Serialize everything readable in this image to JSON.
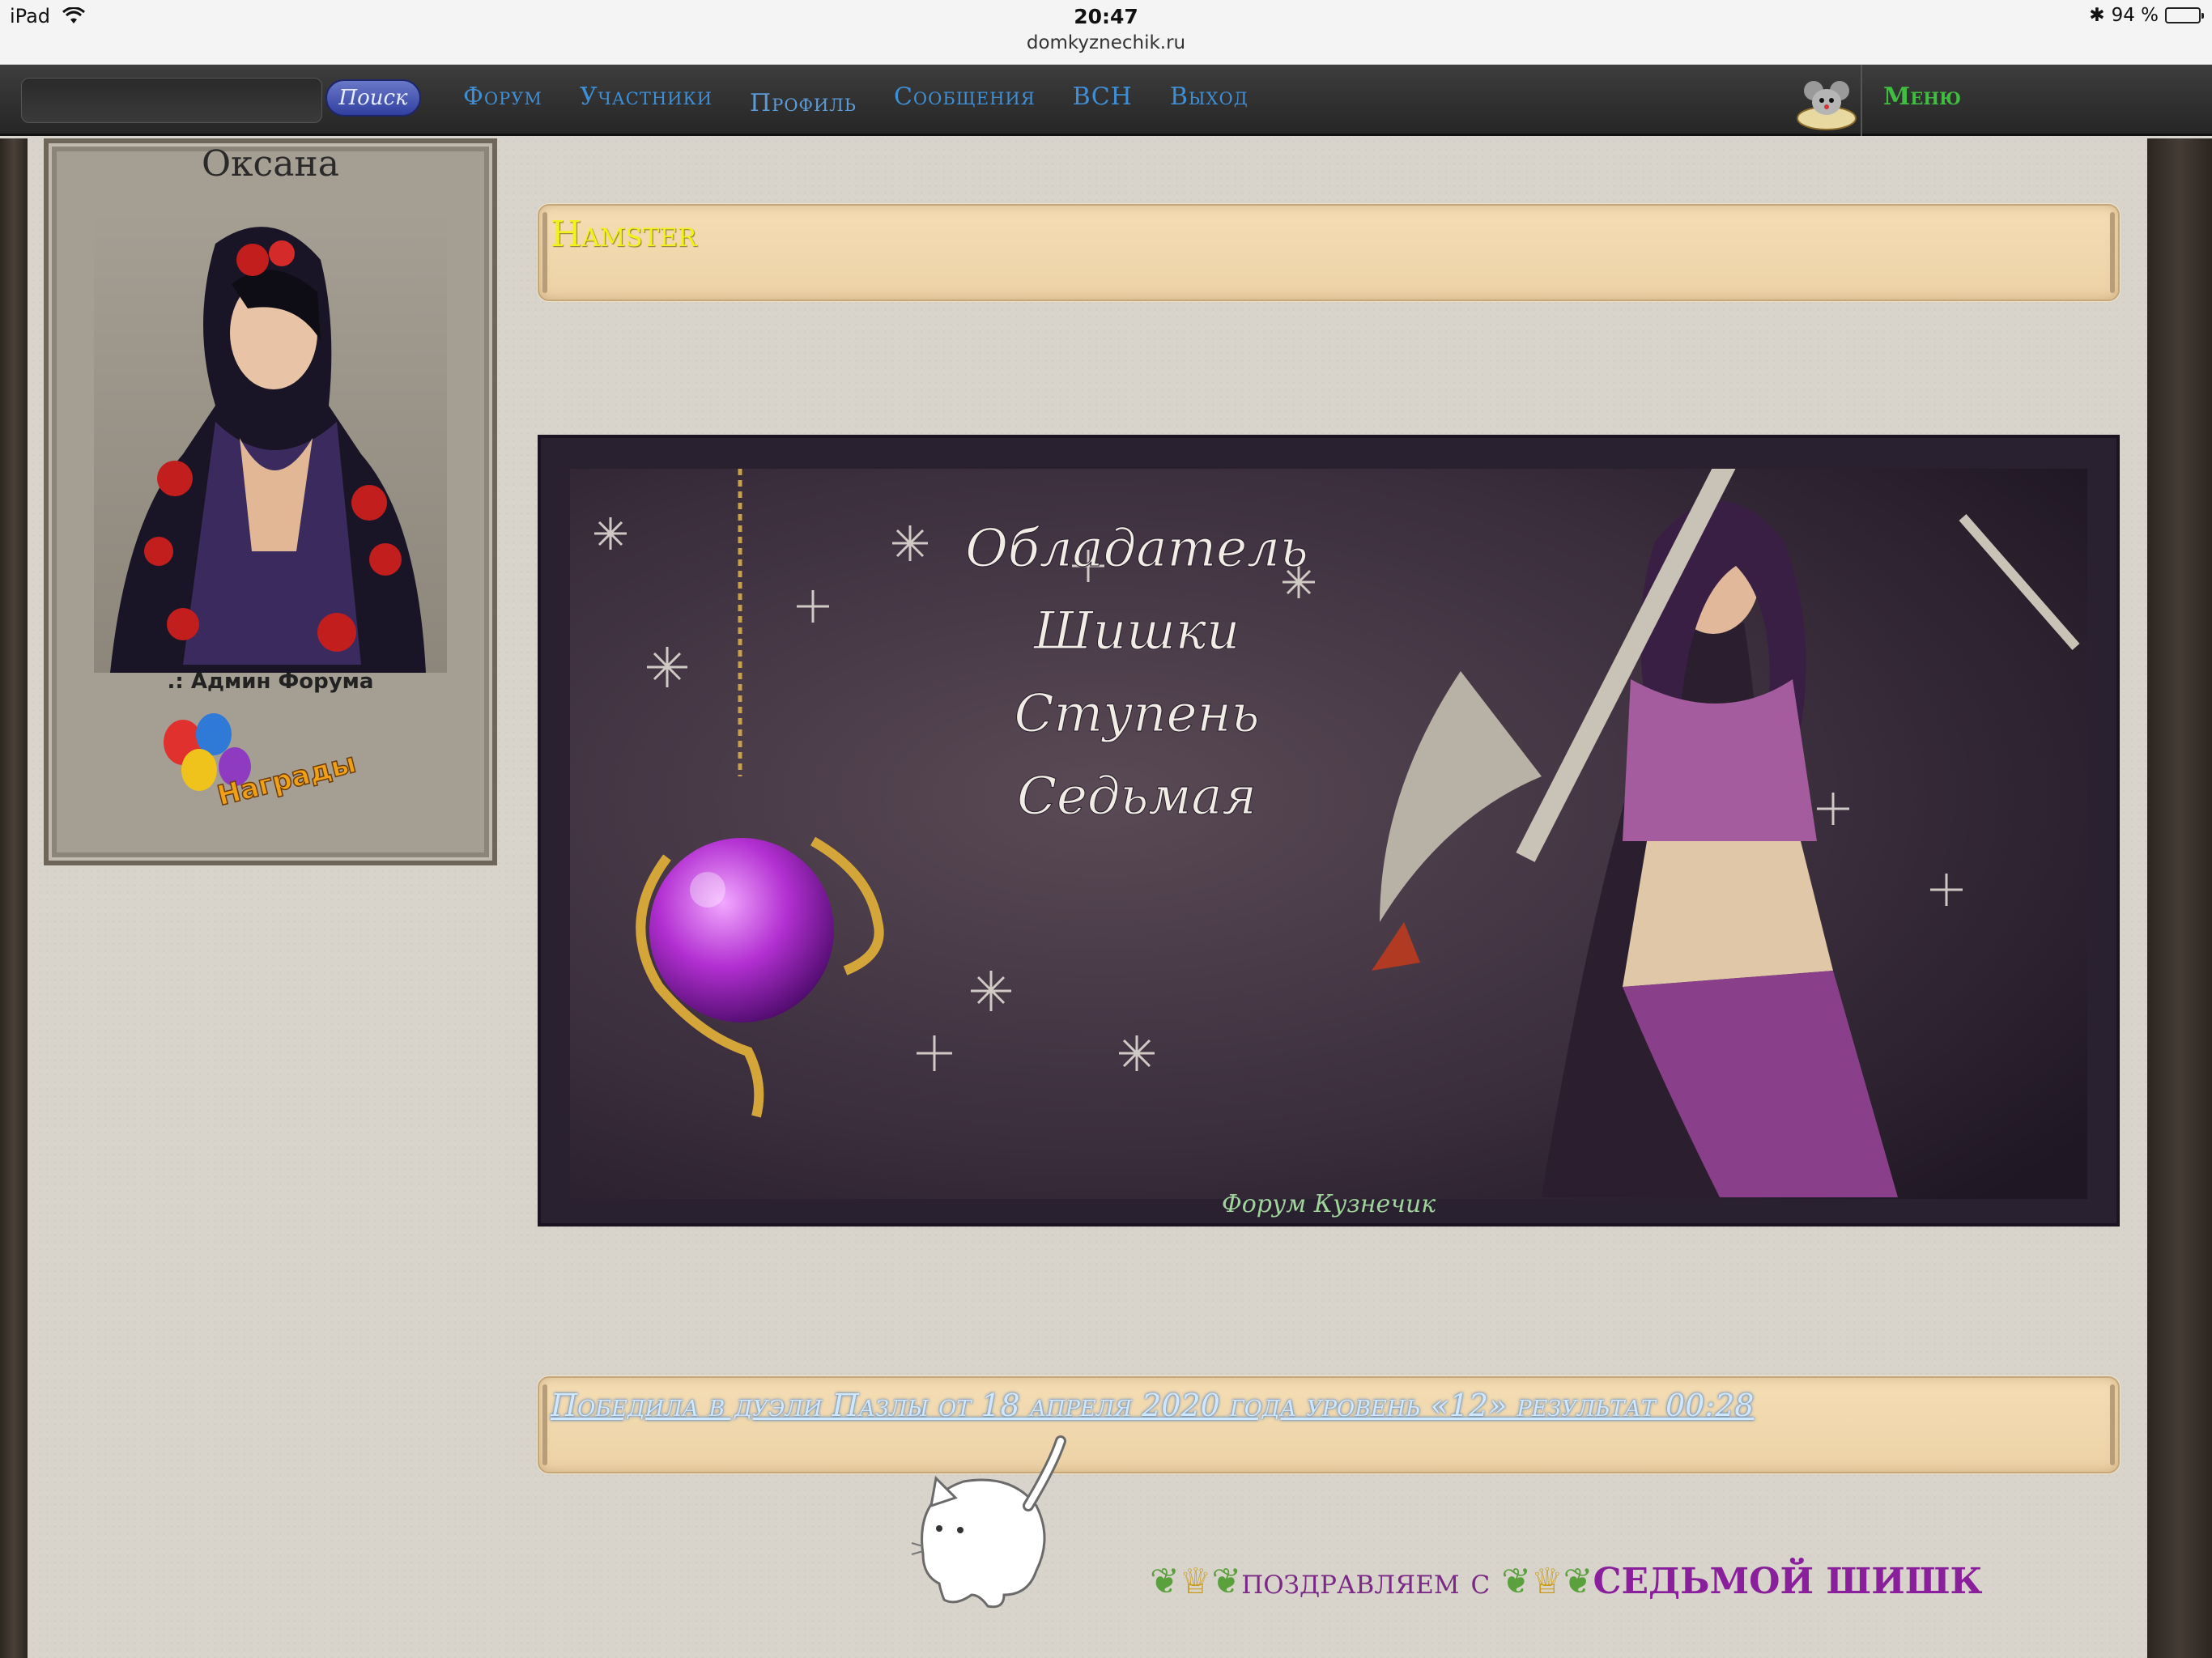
{
  "status_bar": {
    "device": "iPad",
    "time": "20:47",
    "url": "domkyznechik.ru",
    "battery": "94 %",
    "battery_level": 0.94
  },
  "nav": {
    "search_placeholder": "",
    "search_button": "Поиск",
    "links": [
      "Форум",
      "Участники",
      "Профиль",
      "Сообщения",
      "ВСН",
      "Выход"
    ],
    "menu": "Меню"
  },
  "profile": {
    "name": "Оксана",
    "rank": ".: Админ Форума",
    "awards_label": "Награды"
  },
  "post": {
    "title": "Hamster",
    "banner_lines": [
      "Обладатель",
      "Шишки",
      "Ступень",
      "Седьмая"
    ],
    "banner_signature": "Форум Кузнечик",
    "caption": "Победила в дуэли Пазлы от 18 апреля 2020 года уровень  «12» результат 00:28"
  },
  "congrats": {
    "part1": "поздравляем с",
    "part2": "СЕДЬМОЙ ШИШК"
  },
  "colors": {
    "nav_link": "#3f8fd6",
    "menu": "#3fbe3f",
    "title": "#f2f21a",
    "parchment": "#f2d9ae",
    "banner_bg": "#2e2433"
  }
}
